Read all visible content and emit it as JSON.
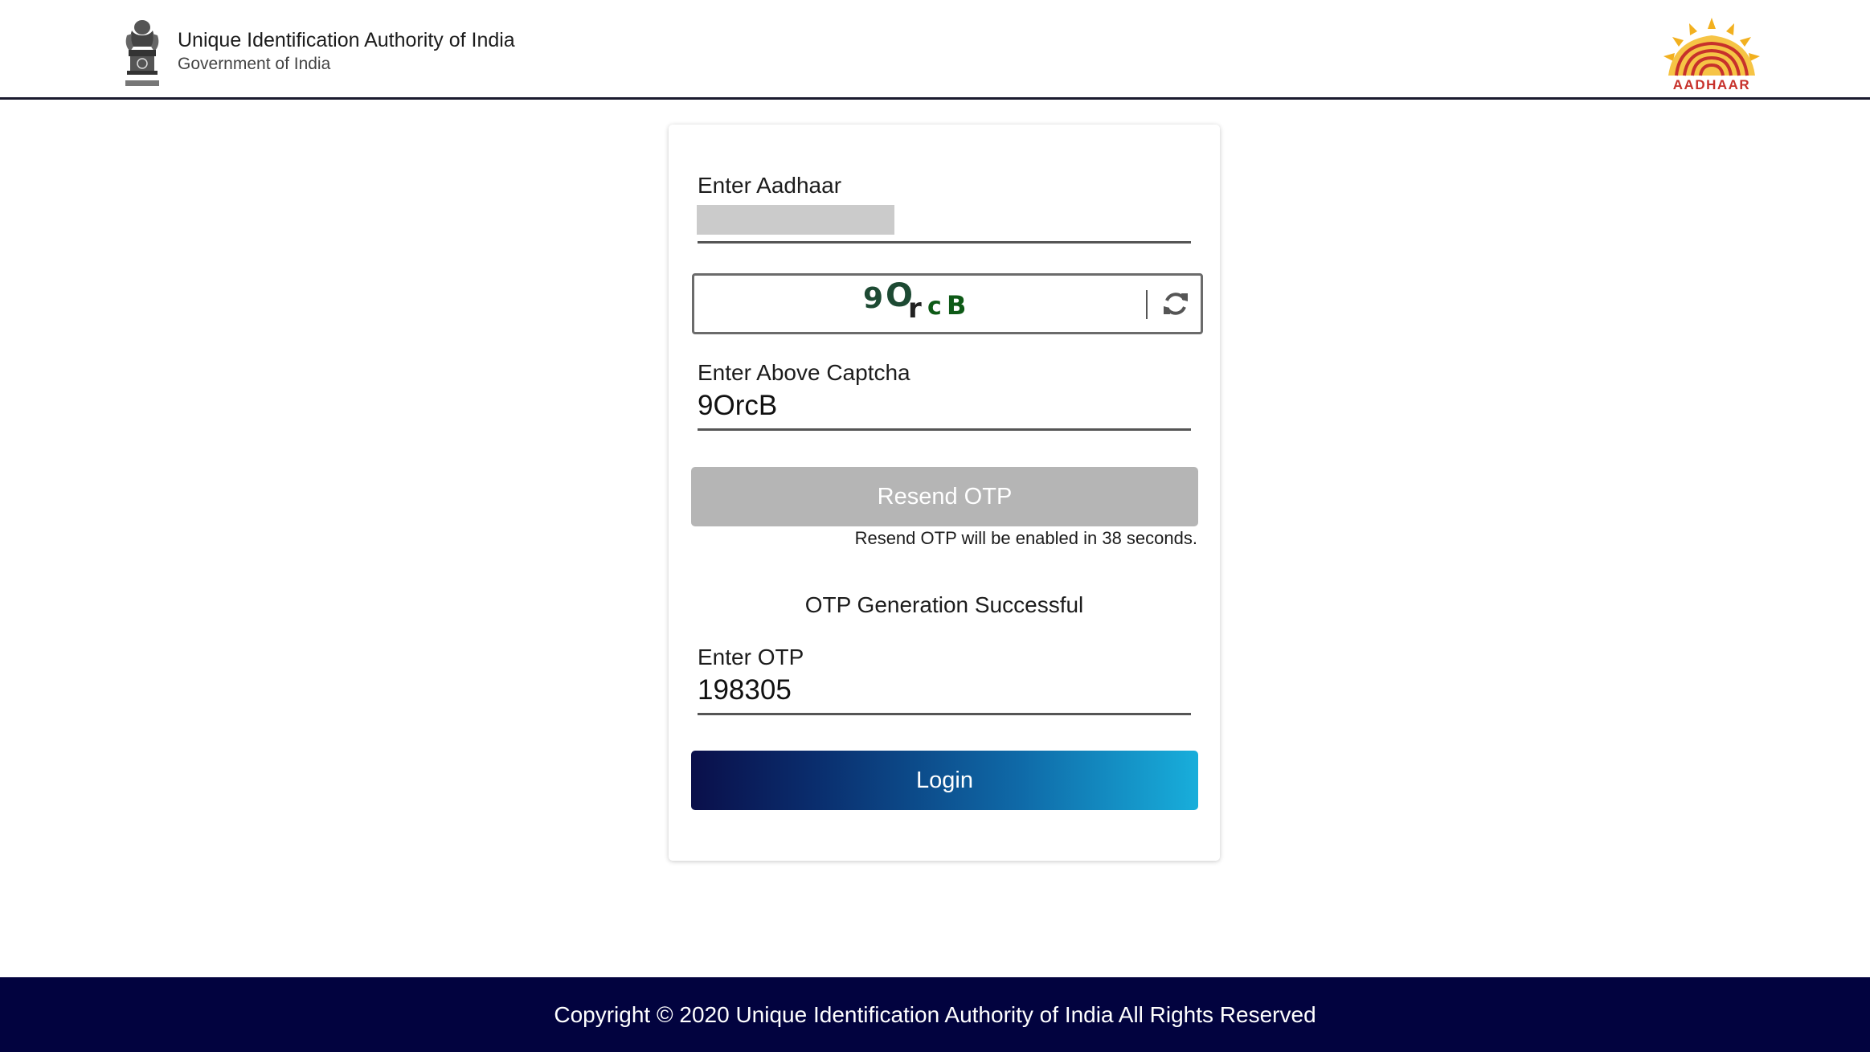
{
  "header": {
    "org_name": "Unique Identification Authority of India",
    "org_sub": "Government of India",
    "emblem_icon": "national-emblem-icon",
    "logo_icon": "aadhaar-logo-icon",
    "logo_text": "AADHAAR"
  },
  "form": {
    "aadhaar_label": "Enter Aadhaar",
    "captcha_chars": [
      "9",
      "O",
      "r",
      "c",
      "B"
    ],
    "captcha_label": "Enter Above Captcha",
    "captcha_value": "9OrcB",
    "resend_label": "Resend OTP",
    "resend_note": "Resend OTP will be enabled in 38 seconds.",
    "otp_status": "OTP Generation Successful",
    "otp_label": "Enter OTP",
    "otp_value": "198305",
    "login_label": "Login"
  },
  "footer": {
    "copyright": "Copyright © 2020 Unique Identification Authority of India All Rights Reserved"
  },
  "colors": {
    "footer_bg": "#02033f",
    "resend_disabled": "#b5b5b5",
    "login_gradient_start": "#0a0f4a",
    "login_gradient_end": "#18aedb",
    "captcha_dark_green": "#1d4a33",
    "captcha_green": "#0e5a17",
    "logo_red": "#c7312b",
    "logo_yellow": "#f2b01e"
  }
}
